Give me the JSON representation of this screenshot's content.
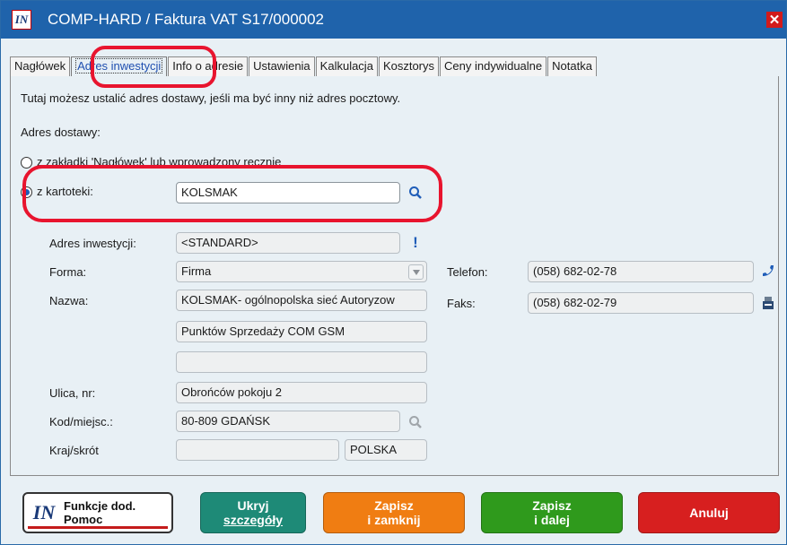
{
  "window": {
    "title": "COMP-HARD / Faktura VAT S17/000002",
    "app_logo": "IN"
  },
  "tabs": [
    {
      "label": "Nagłówek",
      "active": false
    },
    {
      "label": "Adres inwestycji",
      "active": true
    },
    {
      "label": "Info o adresie",
      "active": false
    },
    {
      "label": "Ustawienia",
      "active": false
    },
    {
      "label": "Kalkulacja",
      "active": false
    },
    {
      "label": "Kosztorys",
      "active": false
    },
    {
      "label": "Ceny indywidualne",
      "active": false
    },
    {
      "label": "Notatka",
      "active": false
    }
  ],
  "panel": {
    "info_text": "Tutaj możesz ustalić adres dostawy, jeśli ma być inny niż adres pocztowy.",
    "delivery_label": "Adres dostawy:",
    "radio_tab": "z zakładki 'Nagłówek' lub wprowadzony ręcznie",
    "radio_card": "z kartoteki:",
    "card_value": "KOLSMAK",
    "investment_label": "Adres inwestycji:",
    "investment_value": "<STANDARD>",
    "form_label": "Forma:",
    "form_value": "Firma",
    "name_label": "Nazwa:",
    "name_line1": "KOLSMAK- ogólnopolska sieć Autoryzow",
    "name_line2": "Punktów Sprzedaży COM GSM",
    "name_line3": "",
    "street_label": "Ulica, nr:",
    "street_value": "Obrońców pokoju 2",
    "postal_label": "Kod/miejsc.:",
    "postal_value": "80-809 GDAŃSK",
    "country_label": "Kraj/skrót",
    "country_short": "",
    "country_value": "POLSKA",
    "phone_label": "Telefon:",
    "phone_value": "(058) 682-02-78",
    "fax_label": "Faks:",
    "fax_value": "(058) 682-02-79"
  },
  "buttons": {
    "helper_line1": "Funkcje dod.",
    "helper_line2": "Pomoc",
    "hide_line1": "Ukryj",
    "hide_line2": "szczegóły",
    "save_close_line1": "Zapisz",
    "save_close_line2": "i zamknij",
    "save_next_line1": "Zapisz",
    "save_next_line2": "i dalej",
    "cancel": "Anuluj"
  },
  "colors": {
    "titlebar": "#1f63ab",
    "panel_bg": "#e8f0f5",
    "hide_button": "#1e8a77",
    "save_close_button": "#f07d12",
    "save_next_button": "#2f9a1c",
    "cancel_button": "#d71f1f",
    "annotation": "#e8142e"
  },
  "icons": {
    "search": "search-icon",
    "warning": "exclamation-icon",
    "phone": "phone-icon",
    "fax": "fax-icon",
    "dropdown": "chevron-down-icon",
    "close": "close-icon"
  }
}
